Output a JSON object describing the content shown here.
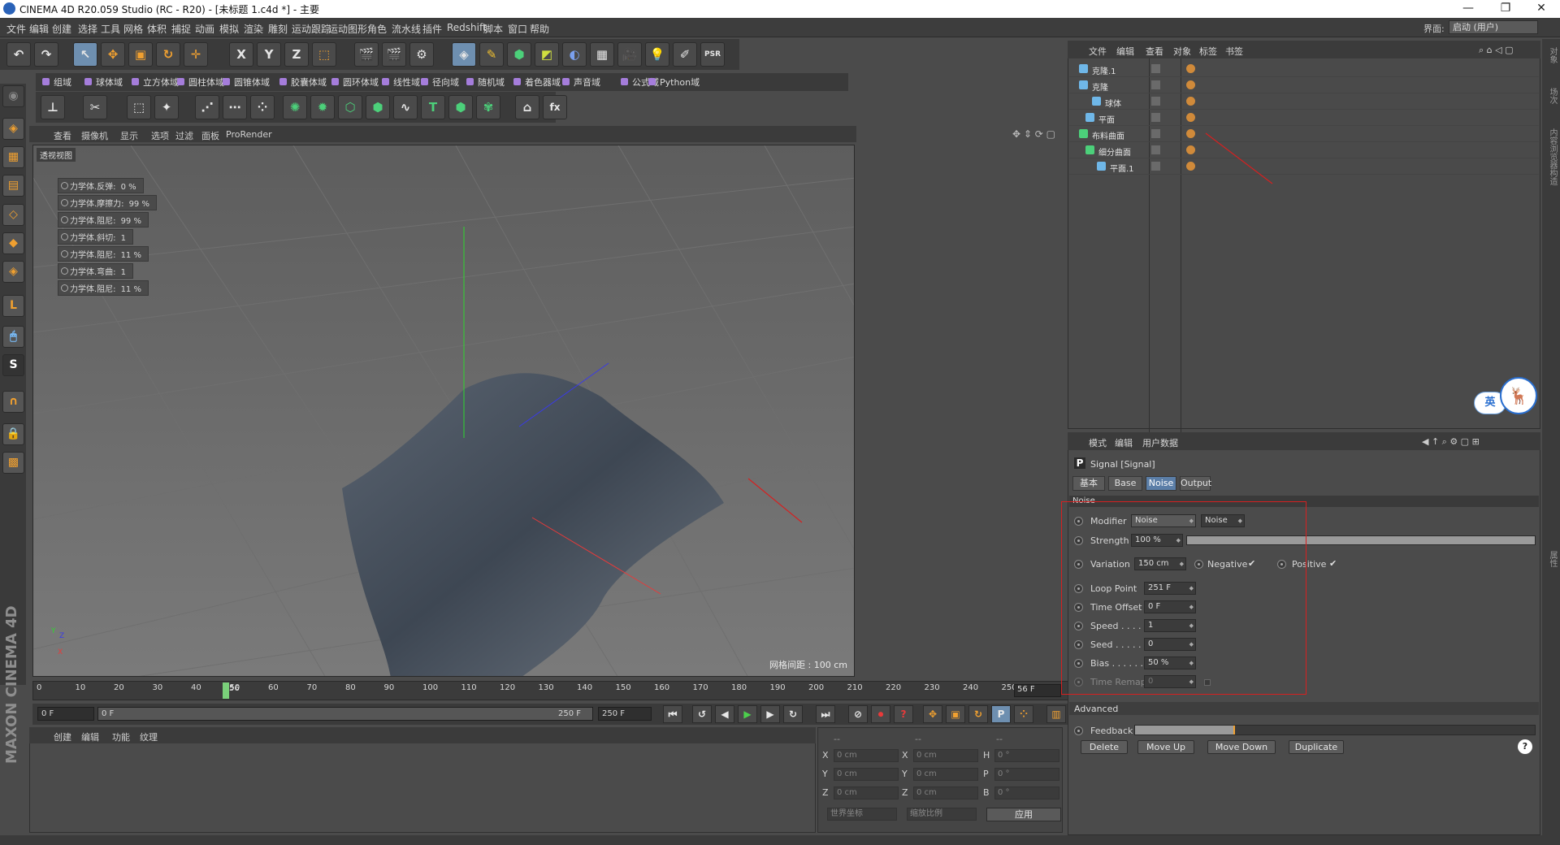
{
  "window": {
    "title": "CINEMA 4D R20.059 Studio (RC - R20) - [未标题 1.c4d *] - 主要",
    "min": "—",
    "max": "❐",
    "close": "✕"
  },
  "menubar": [
    "文件",
    "编辑",
    "创建",
    "选择",
    "工具",
    "网格",
    "体积",
    "捕捉",
    "动画",
    "模拟",
    "渲染",
    "雕刻",
    "运动跟踪",
    "运动图形",
    "角色",
    "流水线",
    "插件",
    "Redshift",
    "脚本",
    "窗口",
    "帮助"
  ],
  "layout": {
    "label": "界面:",
    "value": "启动 (用户)"
  },
  "fieldbar": [
    "组域",
    "球体域",
    "立方体域",
    "圆柱体域",
    "圆锥体域",
    "胶囊体域",
    "圆环体域",
    "线性域",
    "径向域",
    "随机域",
    "着色器域",
    "声音域",
    "公式域",
    "Python域"
  ],
  "viewport_menu": [
    "查看",
    "摄像机",
    "显示",
    "选项",
    "过滤",
    "面板",
    "ProRender"
  ],
  "viewport": {
    "label": "透视视图",
    "grid_readout": "网格间距 : 100 cm",
    "hud": [
      {
        "label": "力学体.反弹:",
        "value": "0 %"
      },
      {
        "label": "力学体.摩擦力:",
        "value": "99 %"
      },
      {
        "label": "力学体.阻尼:",
        "value": "99 %"
      },
      {
        "label": "力学体.斜切:",
        "value": "1"
      },
      {
        "label": "力学体.阻尼:",
        "value": "11 %"
      },
      {
        "label": "力学体.弯曲:",
        "value": "1"
      },
      {
        "label": "力学体.阻尼:",
        "value": "11 %"
      }
    ]
  },
  "timeline": {
    "ticks": [
      "0",
      "10",
      "20",
      "30",
      "40",
      "50",
      "60",
      "70",
      "80",
      "90",
      "100",
      "110",
      "120",
      "130",
      "140",
      "150",
      "160",
      "170",
      "180",
      "190",
      "200",
      "210",
      "220",
      "230",
      "240",
      "250"
    ],
    "playhead_label": "56",
    "current": "56 F"
  },
  "range": {
    "start": "0 F",
    "slider_start": "0 F",
    "slider_end": "250 F",
    "end": "250 F"
  },
  "material_menu": [
    "创建",
    "编辑",
    "功能",
    "纹理"
  ],
  "brand": "MAXON CINEMA 4D",
  "coords": {
    "head": [
      "--",
      "--",
      "--"
    ],
    "rows": [
      {
        "a": "X",
        "av": "0 cm",
        "b": "X",
        "bv": "0 cm",
        "c": "H",
        "cv": "0 °"
      },
      {
        "a": "Y",
        "av": "0 cm",
        "b": "Y",
        "bv": "0 cm",
        "c": "P",
        "cv": "0 °"
      },
      {
        "a": "Z",
        "av": "0 cm",
        "b": "Z",
        "bv": "0 cm",
        "c": "B",
        "cv": "0 °"
      }
    ],
    "mode1": "世界坐标",
    "mode2": "缩放比例",
    "apply": "应用"
  },
  "objects_menu": [
    "文件",
    "编辑",
    "查看",
    "对象",
    "标签",
    "书签"
  ],
  "objects": [
    {
      "name": "克隆.1"
    },
    {
      "name": "克隆"
    },
    {
      "name": "球体"
    },
    {
      "name": "平面"
    },
    {
      "name": "布料曲面"
    },
    {
      "name": "细分曲面"
    },
    {
      "name": "平面.1"
    }
  ],
  "right_strip": [
    "对象",
    "场次",
    "内容浏览器",
    "构造",
    "属性"
  ],
  "ime": {
    "lang": "英",
    "logo": "🦌"
  },
  "attr_menu": [
    "模式",
    "编辑",
    "用户数据"
  ],
  "attr": {
    "title": "Signal [Signal]",
    "tabs": [
      "基本",
      "Base",
      "Noise",
      "Output"
    ],
    "section": "Noise",
    "modifier_label": "Modifier",
    "modifier_value": "Noise",
    "modifier_extra": "Noise",
    "strength_label": "Strength",
    "strength_value": "100 %",
    "strength_level": 1.0,
    "variation_label": "Variation",
    "variation_value": "150 cm",
    "negative_label": "Negative",
    "positive_label": "Positive",
    "check": "✔",
    "params": [
      {
        "label": "Loop Point",
        "value": "251 F"
      },
      {
        "label": "Time Offset",
        "value": "0 F"
      },
      {
        "label": "Speed . . . .",
        "value": "1"
      },
      {
        "label": "Seed . . . . .",
        "value": "0"
      },
      {
        "label": "Bias . . . . . .",
        "value": "50 %"
      },
      {
        "label": "Time Remap",
        "value": "0"
      }
    ],
    "advanced": "Advanced",
    "feedback_label": "Feedback",
    "feedback_level": 0.25,
    "buttons": [
      "Delete",
      "Move Up",
      "Move Down",
      "Duplicate"
    ],
    "help": "?"
  }
}
